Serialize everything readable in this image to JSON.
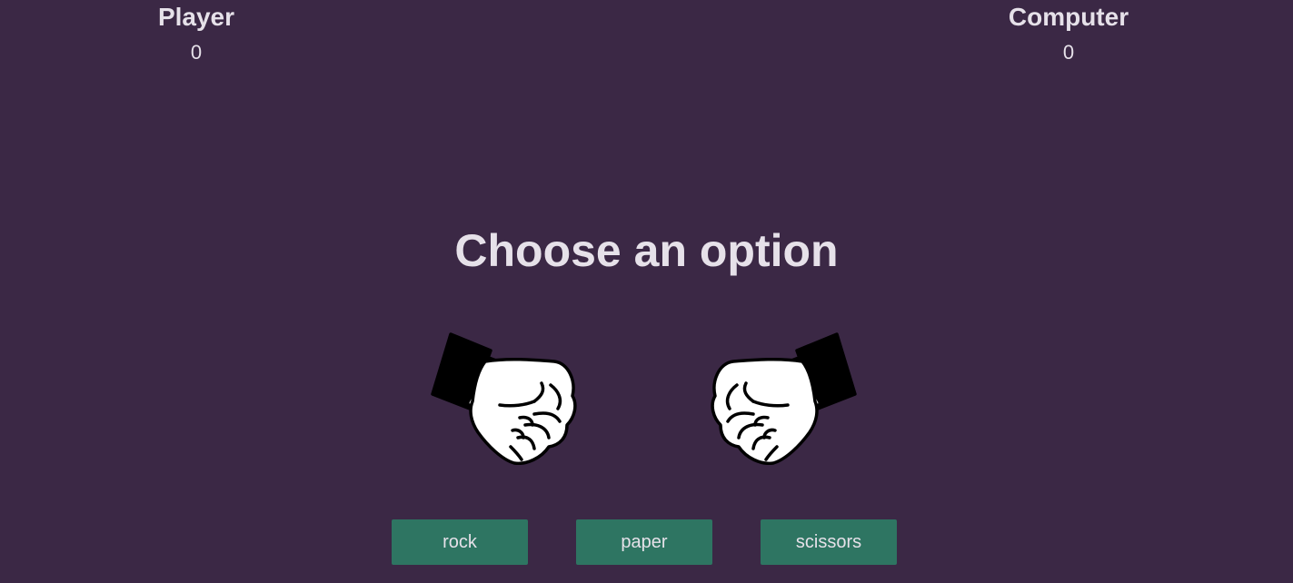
{
  "scoreboard": {
    "player": {
      "label": "Player",
      "score": "0"
    },
    "computer": {
      "label": "Computer",
      "score": "0"
    }
  },
  "prompt": "Choose an option",
  "hands": {
    "player": {
      "icon": "rock-fist-icon"
    },
    "computer": {
      "icon": "rock-fist-icon"
    }
  },
  "options": {
    "rock": "rock",
    "paper": "paper",
    "scissors": "scissors"
  },
  "colors": {
    "background": "#3b2845",
    "text": "#e6e1e9",
    "button": "#2e7562"
  }
}
